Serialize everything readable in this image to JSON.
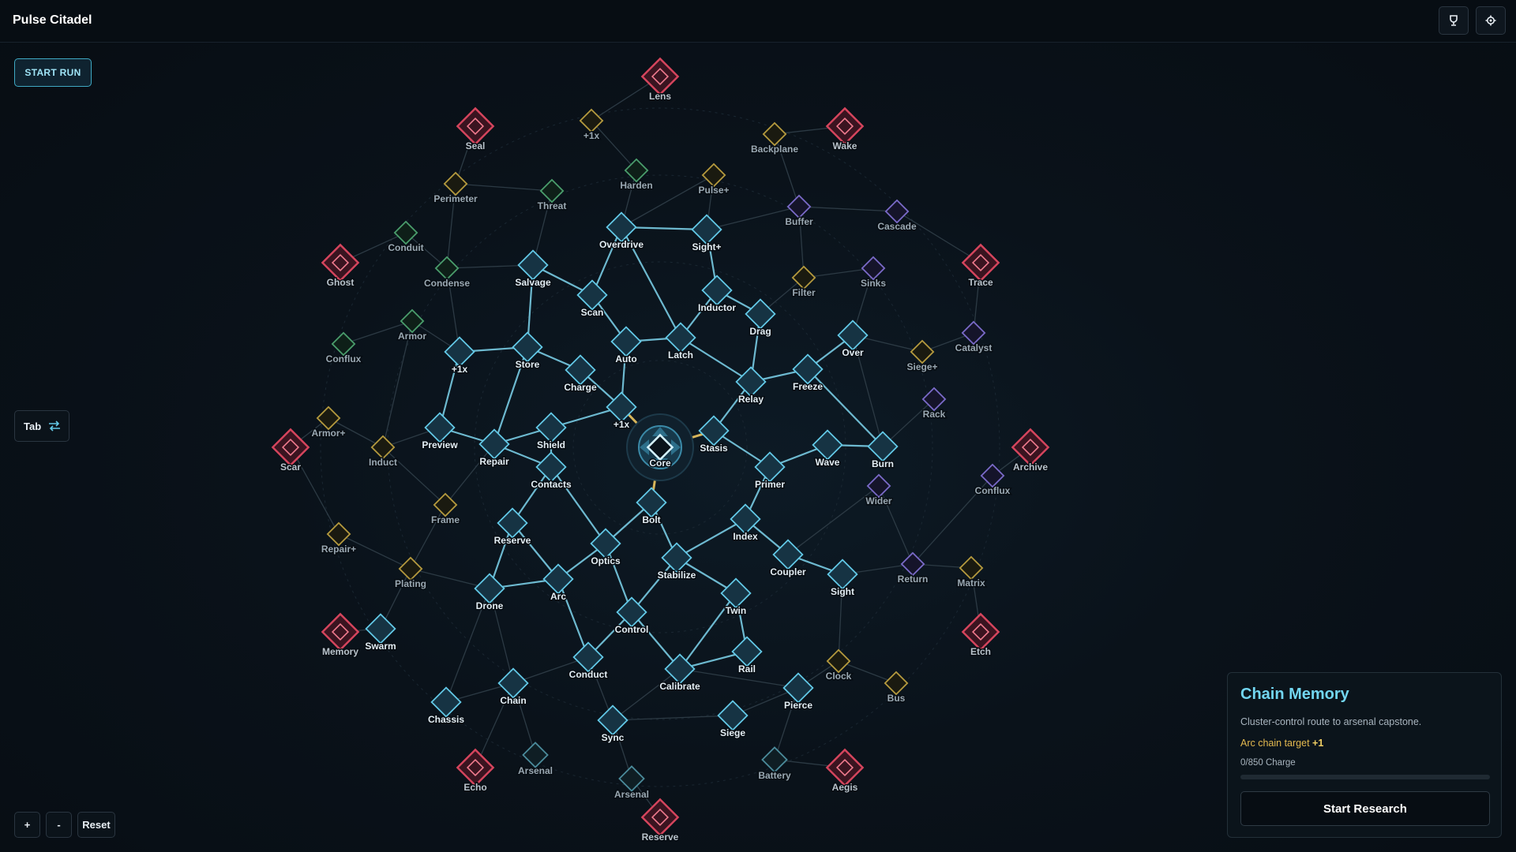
{
  "app": {
    "title": "Pulse Citadel"
  },
  "header": {
    "trophy_icon": "trophy-icon",
    "settings_icon": "gear-icon"
  },
  "controls": {
    "start_run": "START RUN",
    "tab_label": "Tab",
    "zoom_in": "+",
    "zoom_out": "-",
    "reset": "Reset"
  },
  "colors": {
    "active": "#62c8e6",
    "green": "#4a9d6c",
    "gold": "#b59a3e",
    "purple": "#7a6ac8",
    "teal": "#4a8a9a",
    "capstone": "#d6455d"
  },
  "tree": {
    "core": "Core",
    "nodes": [
      {
        "id": "lens",
        "label": "Lens",
        "kind": "capstone"
      },
      {
        "id": "seal",
        "label": "Seal",
        "kind": "capstone"
      },
      {
        "id": "wake",
        "label": "Wake",
        "kind": "capstone"
      },
      {
        "id": "ghost",
        "label": "Ghost",
        "kind": "capstone"
      },
      {
        "id": "trace",
        "label": "Trace",
        "kind": "capstone"
      },
      {
        "id": "scar",
        "label": "Scar",
        "kind": "capstone"
      },
      {
        "id": "archive",
        "label": "Archive",
        "kind": "capstone"
      },
      {
        "id": "memory",
        "label": "Memory",
        "kind": "capstone"
      },
      {
        "id": "etch",
        "label": "Etch",
        "kind": "capstone"
      },
      {
        "id": "echo",
        "label": "Echo",
        "kind": "capstone"
      },
      {
        "id": "aegis",
        "label": "Aegis",
        "kind": "capstone"
      },
      {
        "id": "reserve_cap",
        "label": "Reserve",
        "kind": "capstone"
      },
      {
        "id": "p1x_top",
        "label": "+1x",
        "kind": "gold"
      },
      {
        "id": "backplane",
        "label": "Backplane",
        "kind": "gold"
      },
      {
        "id": "harden",
        "label": "Harden",
        "kind": "green"
      },
      {
        "id": "pulse",
        "label": "Pulse+",
        "kind": "gold"
      },
      {
        "id": "perimeter",
        "label": "Perimeter",
        "kind": "gold"
      },
      {
        "id": "threat",
        "label": "Threat",
        "kind": "green"
      },
      {
        "id": "buffer",
        "label": "Buffer",
        "kind": "purple"
      },
      {
        "id": "cascade",
        "label": "Cascade",
        "kind": "purple"
      },
      {
        "id": "overdrive",
        "label": "Overdrive",
        "kind": "active"
      },
      {
        "id": "sightp",
        "label": "Sight+",
        "kind": "active"
      },
      {
        "id": "conduit",
        "label": "Conduit",
        "kind": "green"
      },
      {
        "id": "condense",
        "label": "Condense",
        "kind": "green"
      },
      {
        "id": "salvage",
        "label": "Salvage",
        "kind": "active"
      },
      {
        "id": "filter",
        "label": "Filter",
        "kind": "gold"
      },
      {
        "id": "sinks",
        "label": "Sinks",
        "kind": "purple"
      },
      {
        "id": "scan",
        "label": "Scan",
        "kind": "active"
      },
      {
        "id": "inductor",
        "label": "Inductor",
        "kind": "active"
      },
      {
        "id": "drag",
        "label": "Drag",
        "kind": "active"
      },
      {
        "id": "armor",
        "label": "Armor",
        "kind": "green"
      },
      {
        "id": "conflux_l",
        "label": "Conflux",
        "kind": "green"
      },
      {
        "id": "catalyst",
        "label": "Catalyst",
        "kind": "purple"
      },
      {
        "id": "p1x_l",
        "label": "+1x",
        "kind": "active"
      },
      {
        "id": "store",
        "label": "Store",
        "kind": "active"
      },
      {
        "id": "auto",
        "label": "Auto",
        "kind": "active"
      },
      {
        "id": "latch",
        "label": "Latch",
        "kind": "active"
      },
      {
        "id": "over",
        "label": "Over",
        "kind": "active"
      },
      {
        "id": "siegep",
        "label": "Siege+",
        "kind": "gold"
      },
      {
        "id": "charge",
        "label": "Charge",
        "kind": "active"
      },
      {
        "id": "relay",
        "label": "Relay",
        "kind": "active"
      },
      {
        "id": "freeze",
        "label": "Freeze",
        "kind": "active"
      },
      {
        "id": "rack",
        "label": "Rack",
        "kind": "purple"
      },
      {
        "id": "p1x_c",
        "label": "+1x",
        "kind": "active"
      },
      {
        "id": "armorp",
        "label": "Armor+",
        "kind": "gold"
      },
      {
        "id": "preview",
        "label": "Preview",
        "kind": "active"
      },
      {
        "id": "shield",
        "label": "Shield",
        "kind": "active"
      },
      {
        "id": "stasis",
        "label": "Stasis",
        "kind": "active"
      },
      {
        "id": "induct",
        "label": "Induct",
        "kind": "gold"
      },
      {
        "id": "repair",
        "label": "Repair",
        "kind": "active"
      },
      {
        "id": "wave",
        "label": "Wave",
        "kind": "active"
      },
      {
        "id": "burn",
        "label": "Burn",
        "kind": "active"
      },
      {
        "id": "contacts",
        "label": "Contacts",
        "kind": "active"
      },
      {
        "id": "primer",
        "label": "Primer",
        "kind": "active"
      },
      {
        "id": "conflux_r",
        "label": "Conflux",
        "kind": "purple"
      },
      {
        "id": "wider",
        "label": "Wider",
        "kind": "purple"
      },
      {
        "id": "frame",
        "label": "Frame",
        "kind": "gold"
      },
      {
        "id": "bolt",
        "label": "Bolt",
        "kind": "active"
      },
      {
        "id": "index",
        "label": "Index",
        "kind": "active"
      },
      {
        "id": "reserve",
        "label": "Reserve",
        "kind": "active"
      },
      {
        "id": "repairp",
        "label": "Repair+",
        "kind": "gold"
      },
      {
        "id": "optics",
        "label": "Optics",
        "kind": "active"
      },
      {
        "id": "stabilize",
        "label": "Stabilize",
        "kind": "active"
      },
      {
        "id": "coupler",
        "label": "Coupler",
        "kind": "active"
      },
      {
        "id": "plating",
        "label": "Plating",
        "kind": "gold"
      },
      {
        "id": "sight",
        "label": "Sight",
        "kind": "active"
      },
      {
        "id": "return",
        "label": "Return",
        "kind": "purple"
      },
      {
        "id": "matrix",
        "label": "Matrix",
        "kind": "gold"
      },
      {
        "id": "drone",
        "label": "Drone",
        "kind": "active"
      },
      {
        "id": "arc",
        "label": "Arc",
        "kind": "active"
      },
      {
        "id": "twin",
        "label": "Twin",
        "kind": "active"
      },
      {
        "id": "control",
        "label": "Control",
        "kind": "active"
      },
      {
        "id": "swarm",
        "label": "Swarm",
        "kind": "active"
      },
      {
        "id": "rail",
        "label": "Rail",
        "kind": "active"
      },
      {
        "id": "clock",
        "label": "Clock",
        "kind": "gold"
      },
      {
        "id": "conduct",
        "label": "Conduct",
        "kind": "active"
      },
      {
        "id": "calibrate",
        "label": "Calibrate",
        "kind": "active"
      },
      {
        "id": "bus",
        "label": "Bus",
        "kind": "gold"
      },
      {
        "id": "chain",
        "label": "Chain",
        "kind": "active"
      },
      {
        "id": "pierce",
        "label": "Pierce",
        "kind": "active"
      },
      {
        "id": "chassis",
        "label": "Chassis",
        "kind": "active"
      },
      {
        "id": "sync",
        "label": "Sync",
        "kind": "active"
      },
      {
        "id": "siege",
        "label": "Siege",
        "kind": "active"
      },
      {
        "id": "arsenal_l",
        "label": "Arsenal",
        "kind": "teal"
      },
      {
        "id": "battery",
        "label": "Battery",
        "kind": "teal"
      },
      {
        "id": "arsenal_b",
        "label": "Arsenal",
        "kind": "teal"
      }
    ]
  },
  "panel": {
    "title": "Chain Memory",
    "description": "Cluster-control route to arsenal capstone.",
    "bonus_text": "Arc chain target",
    "bonus_value": "+1",
    "charge": "0/850 Charge",
    "progress": 0,
    "button": "Start Research"
  }
}
